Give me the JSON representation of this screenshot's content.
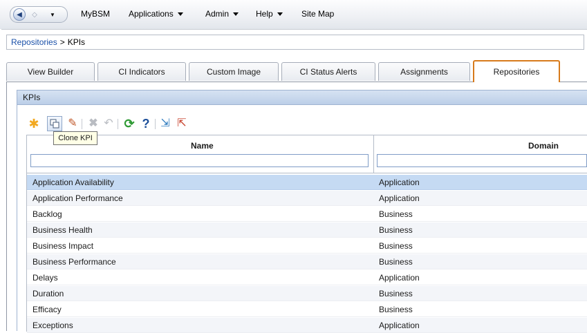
{
  "topbar": {
    "menus": [
      "MyBSM",
      "Applications",
      "Admin",
      "Help",
      "Site Map"
    ]
  },
  "breadcrumb": {
    "parent": "Repositories",
    "separator": ">",
    "current": "KPIs"
  },
  "tabs": [
    {
      "label": "View Builder",
      "active": false
    },
    {
      "label": "CI Indicators",
      "active": false
    },
    {
      "label": "Custom Image",
      "active": false
    },
    {
      "label": "CI Status Alerts",
      "active": false
    },
    {
      "label": "Assignments",
      "active": false
    },
    {
      "label": "Repositories",
      "active": true
    }
  ],
  "panel": {
    "title": "KPIs"
  },
  "toolbar": {
    "icons": [
      "new-icon",
      "clone-icon",
      "edit-icon",
      "delete-icon",
      "undo-icon",
      "refresh-icon",
      "help-icon",
      "import-icon",
      "export-icon"
    ],
    "tooltip": "Clone KPI"
  },
  "grid": {
    "columns": [
      "Name",
      "Domain"
    ],
    "rows": [
      {
        "name": "Application Availability",
        "domain": "Application"
      },
      {
        "name": "Application Performance",
        "domain": "Application"
      },
      {
        "name": "Backlog",
        "domain": "Business"
      },
      {
        "name": "Business Health",
        "domain": "Business"
      },
      {
        "name": "Business Impact",
        "domain": "Business"
      },
      {
        "name": "Business Performance",
        "domain": "Business"
      },
      {
        "name": "Delays",
        "domain": "Application"
      },
      {
        "name": "Duration",
        "domain": "Business"
      },
      {
        "name": "Efficacy",
        "domain": "Business"
      },
      {
        "name": "Exceptions",
        "domain": "Application"
      }
    ],
    "selected_row": "Application Availability"
  },
  "colors": {
    "active_tab_border": "#d77a1b",
    "selected_row": "#c5daf3",
    "panel_header": "#bccfe8"
  }
}
